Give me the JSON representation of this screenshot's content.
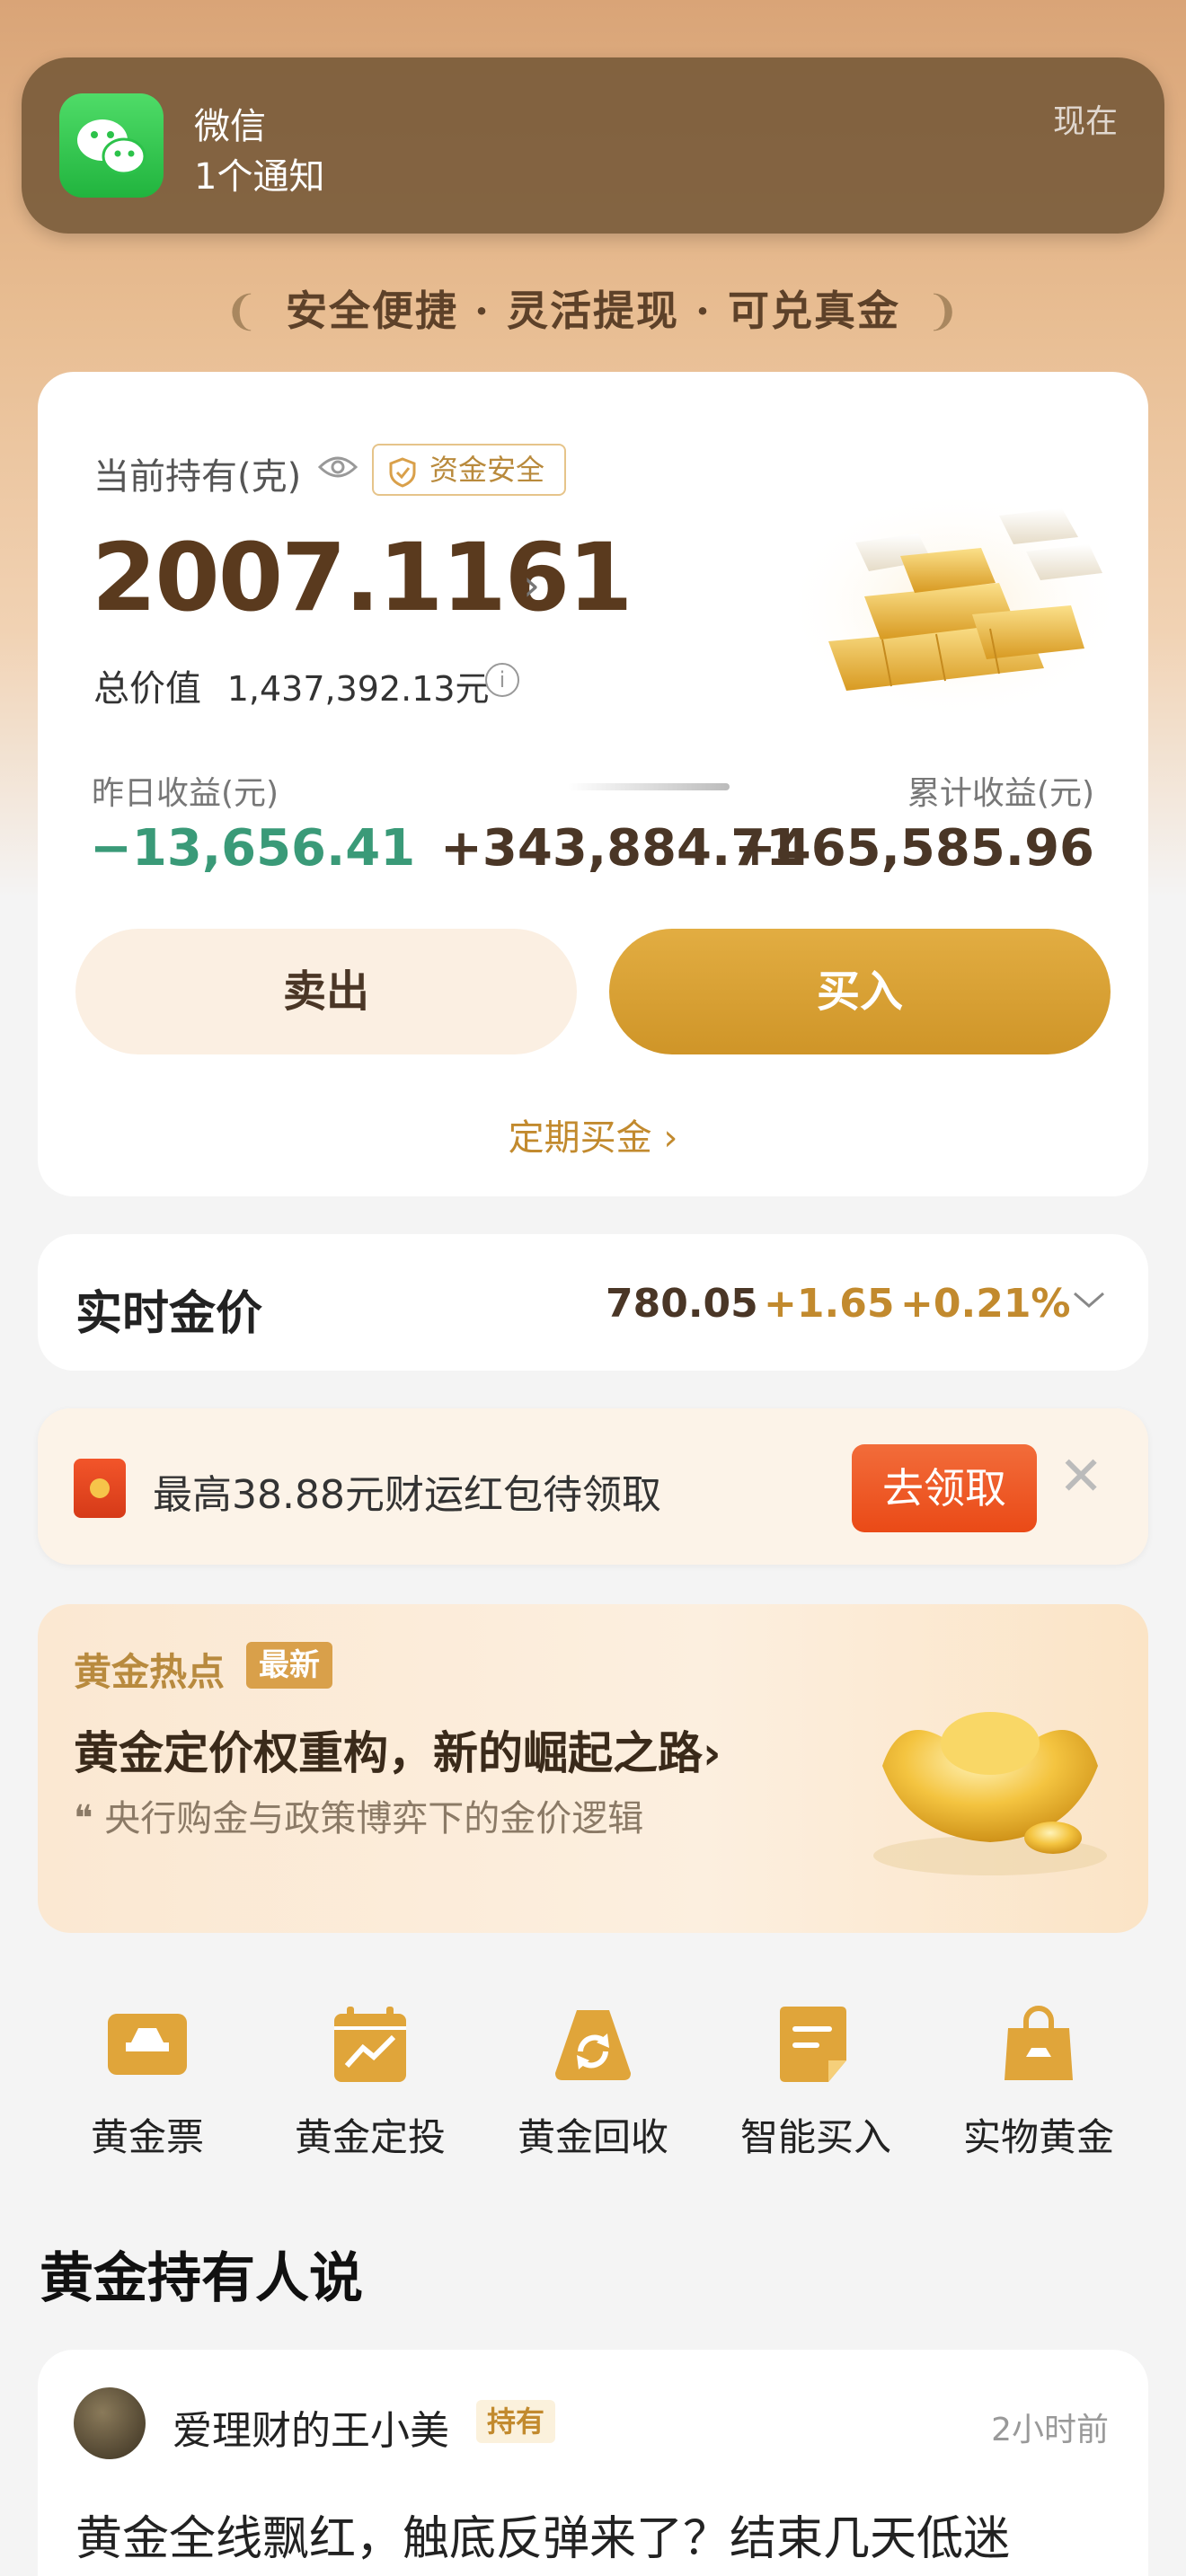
{
  "notification": {
    "app_name": "微信",
    "body": "1个通知",
    "time": "现在"
  },
  "slogan": {
    "text": "安全便捷 · 灵活提现 · 可兑真金"
  },
  "holding": {
    "label": "当前持有(克)",
    "safe_badge": "资金安全",
    "amount": "2007.1161",
    "total_value_label": "总价值",
    "total_value": "1,437,392.13元",
    "yesterday_label": "昨日收益(元)",
    "yesterday_value": "−13,656.41",
    "middle_value": "+343,884.71",
    "cumulative_label": "累计收益(元)",
    "cumulative_value": "+465,585.96",
    "sell_label": "卖出",
    "buy_label": "买入",
    "regular_label": "定期买金 ›"
  },
  "price": {
    "title": "实时金价",
    "value": "780.05",
    "change": "+1.65",
    "percent": "+0.21%"
  },
  "packet": {
    "text": "最高38.88元财运红包待领取",
    "button": "去领取"
  },
  "hot": {
    "label": "黄金热点",
    "badge": "最新",
    "title": "黄金定价权重构，新的崛起之路›",
    "quote": "❝ 央行购金与政策博弈下的金价逻辑"
  },
  "grid": [
    {
      "label": "黄金票",
      "icon": "gold-ticket-icon"
    },
    {
      "label": "黄金定投",
      "icon": "calendar-chart-icon"
    },
    {
      "label": "黄金回收",
      "icon": "recycle-icon"
    },
    {
      "label": "智能买入",
      "icon": "document-icon"
    },
    {
      "label": "实物黄金",
      "icon": "shopping-bag-icon"
    }
  ],
  "section": {
    "title": "黄金持有人说"
  },
  "post": {
    "user": "爱理财的王小美",
    "tag": "持有",
    "time": "2小时前",
    "text": "黄金全线飘红，触底反弹来了？结束几天低迷"
  },
  "colors": {
    "gold": "#d9a04a",
    "brown": "#5a3a1e",
    "green": "#3a9a78",
    "red": "#ea4a17"
  }
}
